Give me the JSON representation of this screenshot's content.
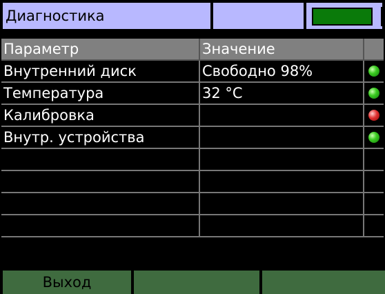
{
  "title_bar": {
    "title": "Диагностика",
    "progress": 1.0,
    "colors": {
      "background": "#b8b8ff",
      "progress": "#0a7a0a"
    }
  },
  "table": {
    "columns": [
      "Параметр",
      "Значение",
      ""
    ],
    "rows": [
      {
        "param": "Внутренний диск",
        "value": "Свободно 98%",
        "status": "green"
      },
      {
        "param": "Температура",
        "value": "32 °C",
        "status": "green"
      },
      {
        "param": "Калибровка",
        "value": "",
        "status": "red"
      },
      {
        "param": "Внутр. устройства",
        "value": "",
        "status": "green"
      },
      {
        "param": "",
        "value": "",
        "status": ""
      },
      {
        "param": "",
        "value": "",
        "status": ""
      },
      {
        "param": "",
        "value": "",
        "status": ""
      },
      {
        "param": "",
        "value": "",
        "status": ""
      }
    ]
  },
  "footer": {
    "buttons": [
      "Выход",
      "",
      ""
    ]
  },
  "colors": {
    "header_bg": "#808080",
    "footer_button": "#3f6b3f",
    "led_green": "#3ccc22",
    "led_red": "#e03030"
  }
}
